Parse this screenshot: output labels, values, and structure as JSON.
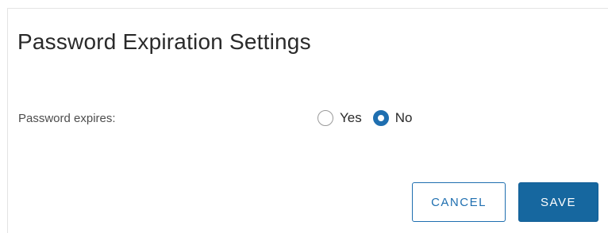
{
  "dialog": {
    "title": "Password Expiration Settings"
  },
  "form": {
    "password_expires": {
      "label": "Password expires:",
      "options": [
        {
          "label": "Yes",
          "selected": false
        },
        {
          "label": "No",
          "selected": true
        }
      ],
      "selected_value": "No"
    }
  },
  "actions": {
    "cancel_label": "CANCEL",
    "save_label": "SAVE"
  },
  "colors": {
    "accent": "#1f6fb0",
    "primary_button": "#16679f"
  }
}
